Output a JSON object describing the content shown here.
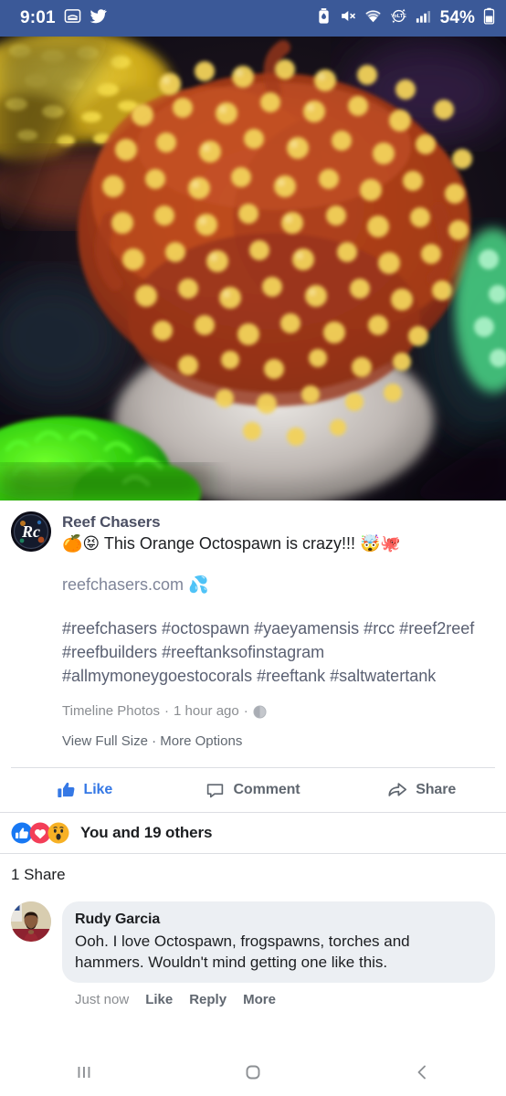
{
  "status_bar": {
    "time": "9:01",
    "battery_percent": "54%",
    "icons": [
      "messenger-icon",
      "twitter-icon",
      "battery-saver-icon",
      "mute-icon",
      "wifi-icon",
      "volte-icon",
      "signal-icon",
      "battery-icon"
    ],
    "background_color": "#3b5998"
  },
  "post": {
    "page_name": "Reef Chasers",
    "message_emoji_lead": "🍊😝",
    "message": " This Orange Octospawn is crazy!!! ",
    "message_emoji_trail": "🤯🐙",
    "link_text": "reefchasers.com",
    "link_emoji": "💦",
    "hashtags": "#reefchasers #octospawn #yaeyamensis #rcc #reef2reef #reefbuilders #reeftanksofinstagram #allmymoneygoestocorals #reeftank #saltwatertank",
    "album": "Timeline Photos",
    "timestamp": "1 hour ago",
    "privacy_icon": "globe-icon",
    "view_full_size": "View Full Size",
    "separator": "·",
    "more_options": "More Options",
    "photo_alt": "orange-octospawn-coral-photo"
  },
  "action_bar": {
    "like_label": "Like",
    "comment_label": "Comment",
    "share_label": "Share",
    "like_active": true,
    "active_color": "#3578e5",
    "inactive_color": "#606770"
  },
  "reactions": {
    "summary": "You and 19 others",
    "types": [
      "like-reaction-icon",
      "love-reaction-icon",
      "wow-reaction-icon"
    ],
    "shares": "1 Share"
  },
  "comment": {
    "author": "Rudy Garcia",
    "text": "Ooh. I love Octospawn, frogspawns, torches and hammers. Wouldn't mind getting one like this.",
    "time": "Just now",
    "like_label": "Like",
    "reply_label": "Reply",
    "more_label": "More"
  },
  "nav_bar": {
    "recents": "recents-icon",
    "home": "home-icon",
    "back": "back-icon"
  }
}
